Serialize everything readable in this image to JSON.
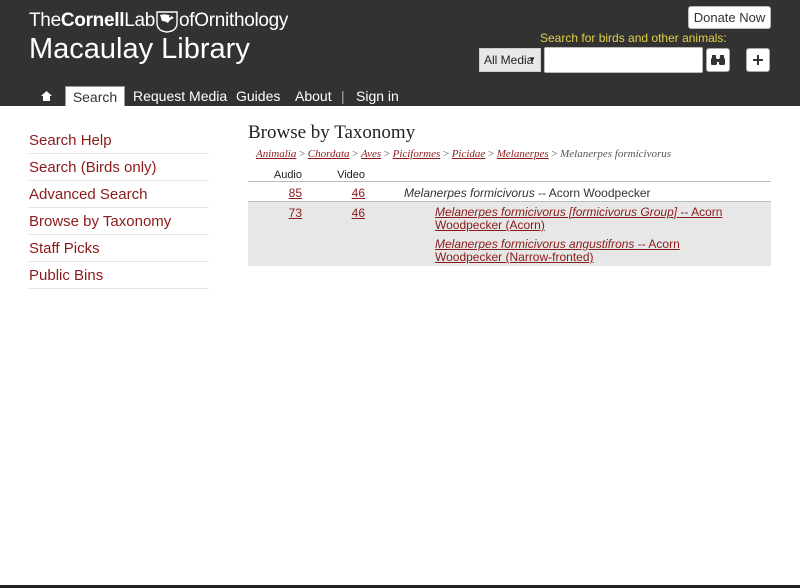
{
  "header": {
    "logo": {
      "the": "The",
      "cornell": "Cornell",
      "lab": "Lab",
      "of": "of",
      "ornithology": "Ornithology"
    },
    "title": "Macaulay Library",
    "donate_label": "Donate Now",
    "search_label": "Search for birds and other animals:",
    "media_select": "All Media",
    "search_placeholder": "",
    "colors": {
      "bar": "#333232",
      "accent": "#e2cf4a",
      "link": "#8b1a1a"
    }
  },
  "nav": {
    "home_icon": "home-icon",
    "items": [
      "Search",
      "Request Media",
      "Guides",
      "About",
      "Sign in"
    ],
    "separator": "|"
  },
  "sidebar": {
    "items": [
      "Search Help",
      "Search (Birds only)",
      "Advanced Search",
      "Browse by Taxonomy",
      "Staff Picks",
      "Public Bins"
    ]
  },
  "main": {
    "heading": "Browse by Taxonomy",
    "breadcrumb": [
      "Animalia",
      "Chordata",
      "Aves",
      "Piciformes",
      "Picidae",
      "Melanerpes"
    ],
    "breadcrumb_current": "Melanerpes formicivorus",
    "breadcrumb_sep": ">",
    "table": {
      "headers": {
        "audio": "Audio",
        "video": "Video"
      },
      "parent": {
        "audio": "85",
        "video": "46",
        "sci_name": "Melanerpes formicivorus",
        "common_name": " -- Acorn Woodpecker"
      },
      "child": {
        "audio": "73",
        "video": "46",
        "subs": [
          {
            "sci_name": "Melanerpes formicivorus [formicivorus Group]",
            "common_name": " -- Acorn Woodpecker (Acorn)"
          },
          {
            "sci_name": "Melanerpes formicivorus angustifrons",
            "common_name": " -- Acorn Woodpecker (Narrow-fronted)"
          }
        ]
      }
    }
  }
}
